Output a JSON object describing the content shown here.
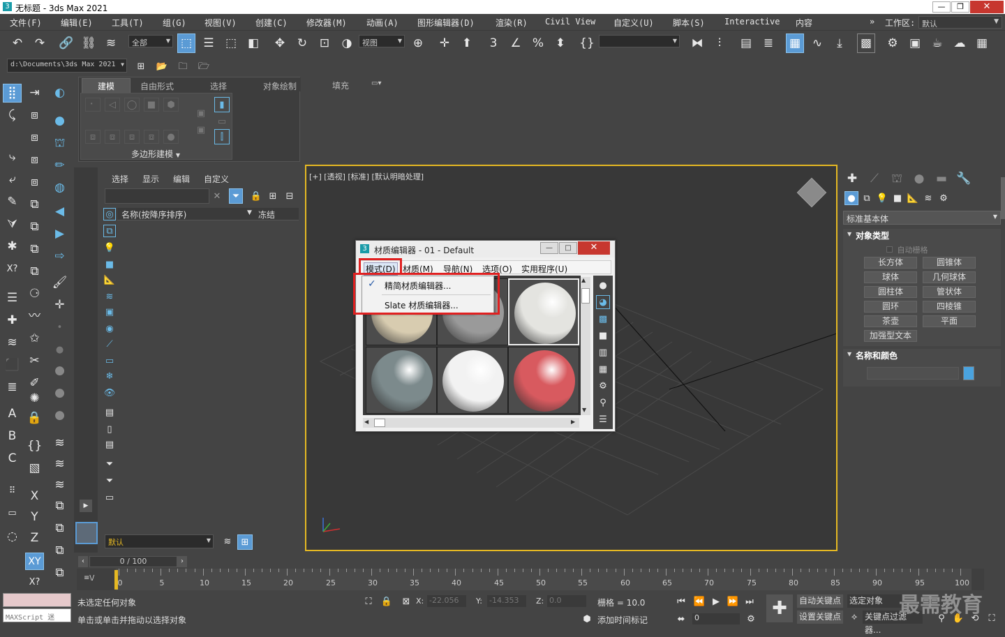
{
  "title": {
    "app": "无标题 - 3ds Max 2021"
  },
  "menu": [
    {
      "label": "文件(F)"
    },
    {
      "label": "编辑(E)"
    },
    {
      "label": "工具(T)"
    },
    {
      "label": "组(G)"
    },
    {
      "label": "视图(V)"
    },
    {
      "label": "创建(C)"
    },
    {
      "label": "修改器(M)"
    },
    {
      "label": "动画(A)"
    },
    {
      "label": "图形编辑器(D)"
    },
    {
      "label": "渲染(R)"
    },
    {
      "label": "Civil View"
    },
    {
      "label": "自定义(U)"
    },
    {
      "label": "脚本(S)"
    },
    {
      "label": "Interactive"
    },
    {
      "label": "内容"
    }
  ],
  "workspace": {
    "label": "工作区:",
    "value": "默认"
  },
  "toolbar": {
    "filter_all": "全部",
    "view_dropdown": "视图",
    "path": "d:\\Documents\\3ds Max 2021"
  },
  "ribbon": {
    "tabs": [
      {
        "label": "建模"
      },
      {
        "label": "自由形式"
      },
      {
        "label": "选择"
      },
      {
        "label": "对象绘制"
      },
      {
        "label": "填充"
      }
    ],
    "group_label": "多边形建模"
  },
  "scene_explorer": {
    "menus": [
      {
        "label": "选择"
      },
      {
        "label": "显示"
      },
      {
        "label": "编辑"
      },
      {
        "label": "自定义"
      }
    ],
    "col_name": "名称(按降序排序)",
    "col_freeze": "冻结",
    "layer": "默认"
  },
  "viewport": {
    "label": "[+] [透视] [标准] [默认明暗处理]"
  },
  "material_editor": {
    "title": "材质编辑器 - 01 - Default",
    "menus": [
      {
        "label": "模式(D)"
      },
      {
        "label": "材质(M)"
      },
      {
        "label": "导航(N)"
      },
      {
        "label": "选项(O)"
      },
      {
        "label": "实用程序(U)"
      }
    ],
    "mode_menu": [
      {
        "label": "精简材质编辑器...",
        "checked": true
      },
      {
        "label": "Slate 材质编辑器...",
        "checked": false
      }
    ],
    "sample_colors": [
      "#d8ccb0",
      "#9a9a9a",
      "#e4e4e0",
      "#7c8a8c",
      "#f2f2f2",
      "#d85a5f"
    ]
  },
  "command_panel": {
    "dropdown": "标准基本体",
    "rollout_object_type": "对象类型",
    "autogrid": "自动栅格",
    "buttons": [
      {
        "label": "长方体"
      },
      {
        "label": "圆锥体"
      },
      {
        "label": "球体"
      },
      {
        "label": "几何球体"
      },
      {
        "label": "圆柱体"
      },
      {
        "label": "管状体"
      },
      {
        "label": "圆环"
      },
      {
        "label": "四棱锥"
      },
      {
        "label": "茶壶"
      },
      {
        "label": "平面"
      }
    ],
    "extended": "加强型文本",
    "rollout_name_color": "名称和颜色",
    "color_swatch": "#4aa3df"
  },
  "timeline": {
    "frame": "0 / 100",
    "ticks": [
      "0",
      "5",
      "10",
      "15",
      "20",
      "25",
      "30",
      "35",
      "40",
      "45",
      "50",
      "55",
      "60",
      "65",
      "70",
      "75",
      "80",
      "85",
      "90",
      "95",
      "100"
    ]
  },
  "status": {
    "maxscript": "MAXScript 迷",
    "line1": "未选定任何对象",
    "line2": "单击或单击并拖动以选择对象",
    "x_label": "X:",
    "x": "-22.056",
    "y_label": "Y:",
    "y": "-14.353",
    "z_label": "Z:",
    "z": "0.0",
    "grid": "栅格 = 10.0",
    "add_time_tag": "添加时间标记",
    "auto_key": "自动关键点",
    "selected": "选定对象",
    "set_key": "设置关键点",
    "key_filter": "关键点过滤器...",
    "frame_spinner": "0"
  },
  "watermark": "最需教育"
}
